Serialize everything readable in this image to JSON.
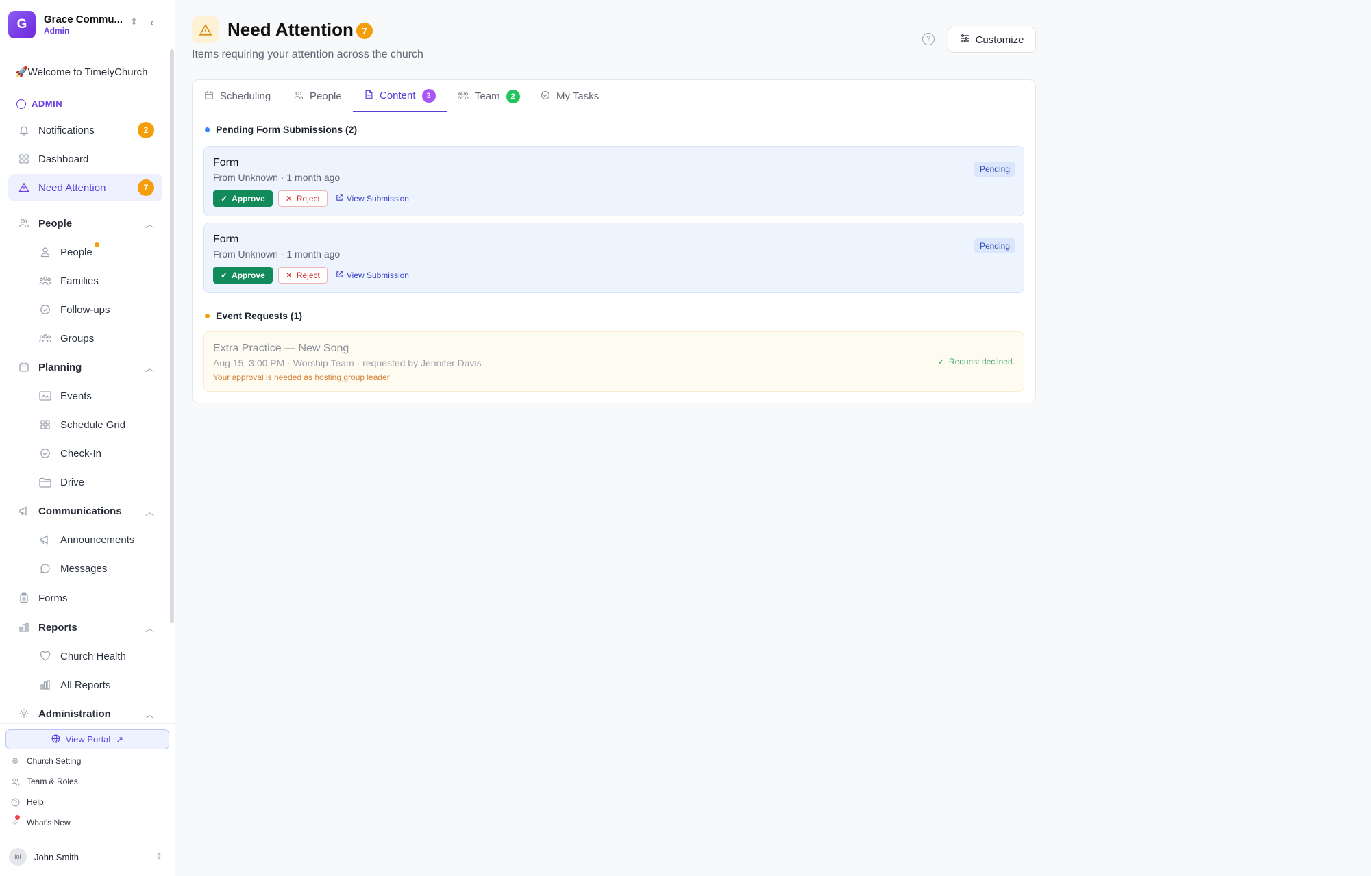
{
  "sidebar": {
    "org_initial": "G",
    "org_name": "Grace Commu...",
    "org_role": "Admin",
    "welcome": "🚀Welcome to TimelyChurch",
    "section_admin": "ADMIN",
    "items": {
      "notifications": "Notifications",
      "notifications_count": "2",
      "dashboard": "Dashboard",
      "need_attention": "Need Attention",
      "need_attention_count": "7",
      "people_group": "People",
      "people": "People",
      "families": "Families",
      "followups": "Follow-ups",
      "groups": "Groups",
      "planning_group": "Planning",
      "events": "Events",
      "schedule_grid": "Schedule Grid",
      "checkin": "Check-In",
      "drive": "Drive",
      "communications_group": "Communications",
      "announcements": "Announcements",
      "messages": "Messages",
      "forms": "Forms",
      "reports_group": "Reports",
      "church_health": "Church Health",
      "all_reports": "All Reports",
      "administration_group": "Administration"
    },
    "bottom": {
      "view_portal": "View Portal",
      "church_setting": "Church Setting",
      "team_roles": "Team & Roles",
      "help": "Help",
      "whats_new": "What's New"
    },
    "user": {
      "avatar_alt": "lol",
      "name": "John Smith"
    }
  },
  "header": {
    "title": "Need Attention",
    "count": "7",
    "subtitle": "Items requiring your attention across the church",
    "customize": "Customize"
  },
  "tabs": [
    {
      "label": "Scheduling",
      "icon": "calendar-icon"
    },
    {
      "label": "People",
      "icon": "users-icon"
    },
    {
      "label": "Content",
      "icon": "file-icon",
      "count": "3",
      "count_color": "#a855f7"
    },
    {
      "label": "Team",
      "icon": "team-icon",
      "count": "2",
      "count_color": "#22c55e"
    },
    {
      "label": "My Tasks",
      "icon": "check-circle-icon"
    }
  ],
  "content": {
    "pending_forms_heading": "Pending Form Submissions (2)",
    "submissions": [
      {
        "title": "Form",
        "meta": "From Unknown · 1 month ago",
        "status": "Pending"
      },
      {
        "title": "Form",
        "meta": "From Unknown · 1 month ago",
        "status": "Pending"
      }
    ],
    "approve_label": "Approve",
    "reject_label": "Reject",
    "view_label": "View Submission",
    "event_requests_heading": "Event Requests (1)",
    "event": {
      "title": "Extra Practice — New Song",
      "meta": "Aug 15, 3:00 PM · Worship Team · requested by Jennifer Davis",
      "note": "Your approval is needed as hosting group leader",
      "status": "Request declined."
    }
  },
  "colors": {
    "accent": "#5b3fd8",
    "warning": "#f59e0b",
    "approve": "#138a5a",
    "reject": "#d12e2e"
  }
}
